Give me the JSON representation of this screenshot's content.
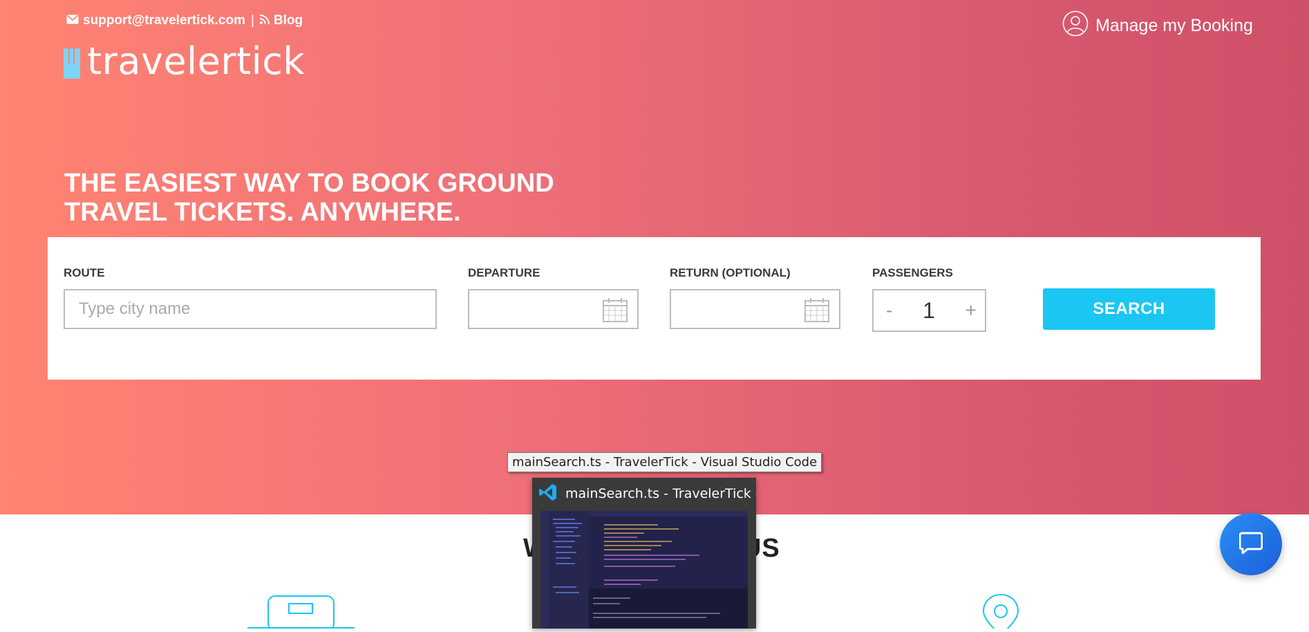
{
  "topbar": {
    "email": "support@travelertick.com",
    "separator": "|",
    "blog_label": "Blog",
    "manage_booking_label": "Manage my Booking"
  },
  "brand": {
    "logo_text": "travelertick"
  },
  "hero": {
    "headline_line1": "THE EASIEST WAY TO BOOK GROUND",
    "headline_line2": "TRAVEL TICKETS. ANYWHERE."
  },
  "search_form": {
    "route_label": "ROUTE",
    "route_placeholder": "Type city name",
    "departure_label": "DEPARTURE",
    "return_label": "RETURN (OPTIONAL)",
    "passengers_label": "PASSENGERS",
    "passengers_minus": "-",
    "passengers_value": "1",
    "passengers_plus": "+",
    "search_button": "SEARCH"
  },
  "section": {
    "title_left": "W",
    "title_right": "US"
  },
  "taskbar_popup": {
    "tooltip": "mainSearch.ts - TravelerTick - Visual Studio Code",
    "title": "mainSearch.ts - TravelerTick - Vi..."
  },
  "colors": {
    "hero_start": "#ff8472",
    "hero_end": "#cf5068",
    "accent": "#1bc6f2",
    "chat": "#2a8ff7"
  }
}
